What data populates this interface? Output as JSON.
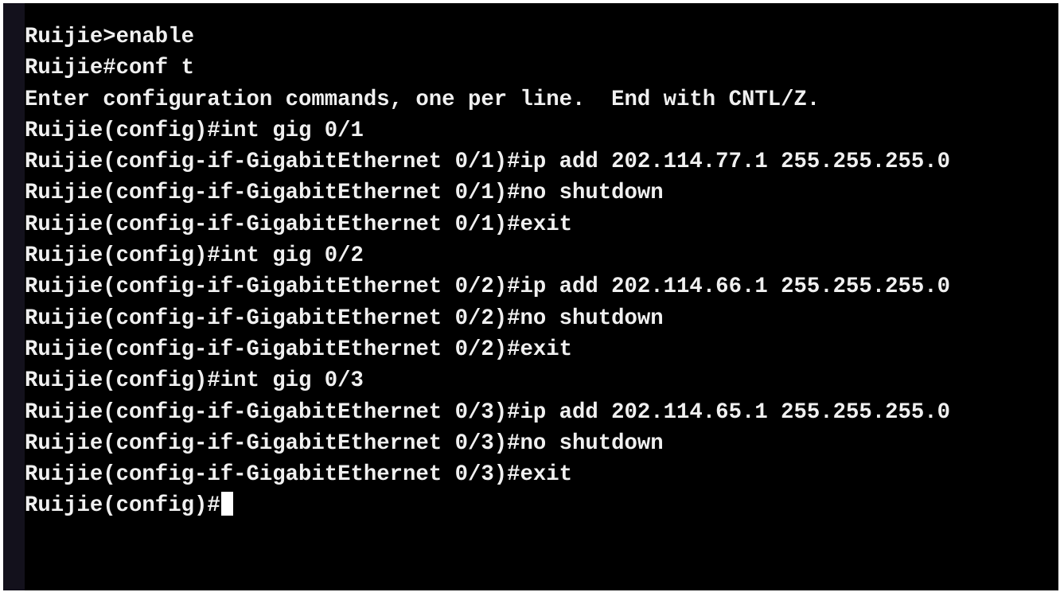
{
  "terminal": {
    "lines": [
      "Ruijie>enable",
      "Ruijie#conf t",
      "Enter configuration commands, one per line.  End with CNTL/Z.",
      "Ruijie(config)#int gig 0/1",
      "Ruijie(config-if-GigabitEthernet 0/1)#ip add 202.114.77.1 255.255.255.0",
      "Ruijie(config-if-GigabitEthernet 0/1)#no shutdown",
      "Ruijie(config-if-GigabitEthernet 0/1)#exit",
      "Ruijie(config)#int gig 0/2",
      "Ruijie(config-if-GigabitEthernet 0/2)#ip add 202.114.66.1 255.255.255.0",
      "Ruijie(config-if-GigabitEthernet 0/2)#no shutdown",
      "Ruijie(config-if-GigabitEthernet 0/2)#exit",
      "Ruijie(config)#int gig 0/3",
      "Ruijie(config-if-GigabitEthernet 0/3)#ip add 202.114.65.1 255.255.255.0",
      "Ruijie(config-if-GigabitEthernet 0/3)#no shutdown",
      "Ruijie(config-if-GigabitEthernet 0/3)#exit"
    ],
    "prompt": "Ruijie(config)#"
  }
}
